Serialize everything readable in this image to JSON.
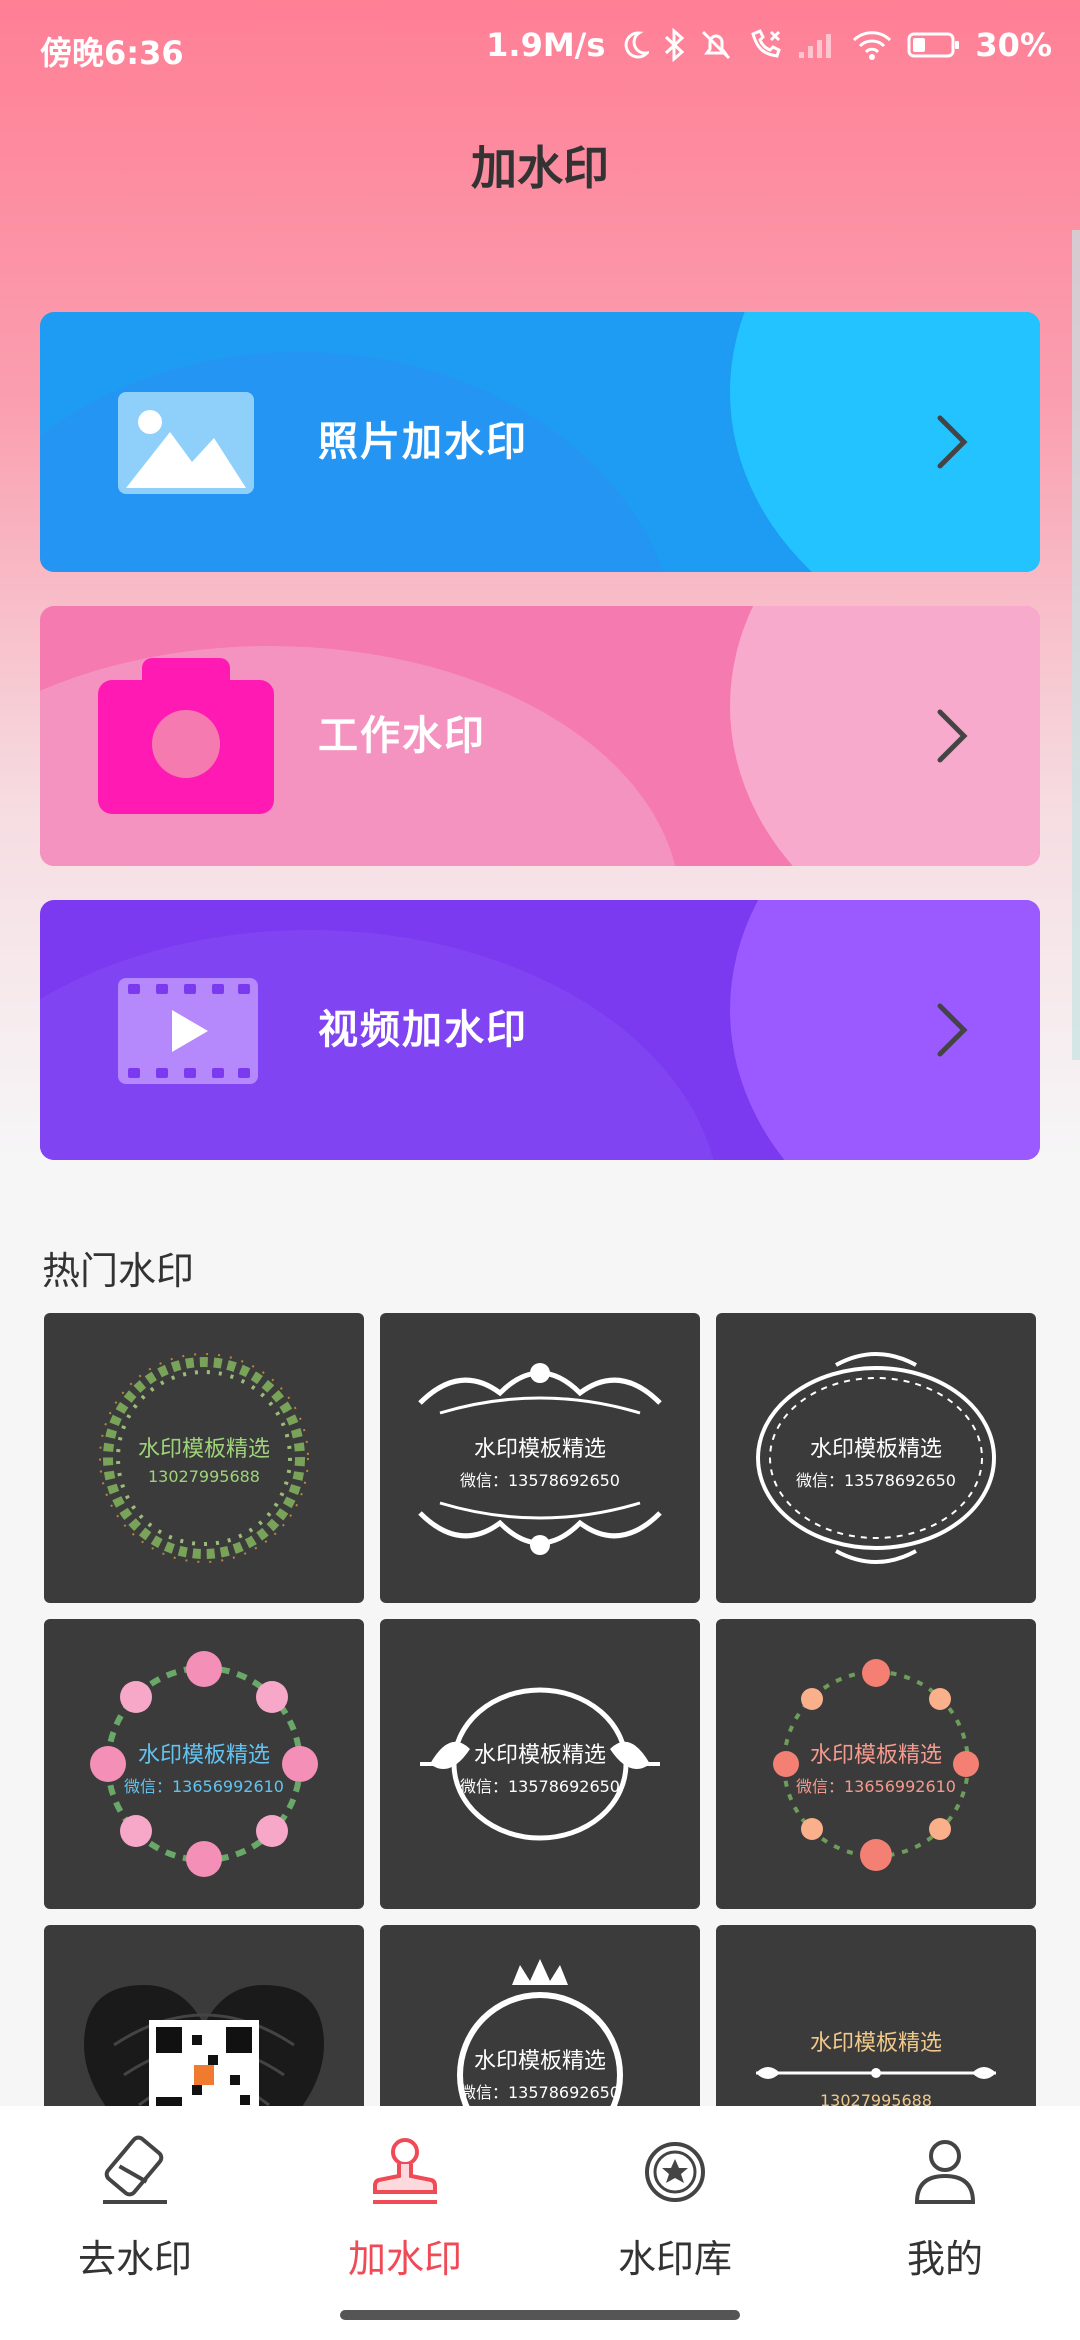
{
  "status_bar": {
    "time": "傍晚6:36",
    "network_speed": "1.9M/s",
    "battery": "30%",
    "icons": [
      "moon-icon",
      "bluetooth-icon",
      "mute-bell-icon",
      "call-missed-icon",
      "signal-icon",
      "wifi-icon",
      "battery-icon"
    ]
  },
  "header": {
    "title": "加水印"
  },
  "cards": [
    {
      "label": "照片加水印",
      "icon": "image-icon"
    },
    {
      "label": "工作水印",
      "icon": "camera-icon"
    },
    {
      "label": "视频加水印",
      "icon": "video-icon"
    }
  ],
  "hot_section": {
    "title": "热门水印",
    "templates": [
      {
        "title": "水印模板精选",
        "subtitle": "13027995688",
        "style": "green-wreath",
        "text_color": "#9fd37a"
      },
      {
        "title": "水印模板精选",
        "subtitle": "微信：13578692650",
        "style": "white-ornament",
        "text_color": "#ffffff"
      },
      {
        "title": "水印模板精选",
        "subtitle": "微信：13578692650",
        "style": "white-circle-frame",
        "text_color": "#ffffff"
      },
      {
        "title": "水印模板精选",
        "subtitle": "微信：13656992610",
        "style": "pink-flower-wreath",
        "text_color": "#63c3f0"
      },
      {
        "title": "水印模板精选",
        "subtitle": "微信：13578692650",
        "style": "white-badge",
        "text_color": "#ffffff"
      },
      {
        "title": "水印模板精选",
        "subtitle": "微信：13656992610",
        "style": "coral-flower-wreath",
        "text_color": "#f59a8e"
      },
      {
        "title": "",
        "subtitle": "",
        "style": "fingerprint-qr",
        "text_color": "#ffffff"
      },
      {
        "title": "水印模板精选",
        "subtitle": "微信：13578692650",
        "style": "crown-circle",
        "text_color": "#ffffff"
      },
      {
        "title": "水印模板精选",
        "subtitle": "13027995688",
        "style": "gold-line",
        "text_color": "#f0c98a"
      }
    ]
  },
  "bottom_nav": {
    "items": [
      {
        "label": "去水印",
        "icon": "eraser-icon",
        "active": false
      },
      {
        "label": "加水印",
        "icon": "stamp-icon",
        "active": true
      },
      {
        "label": "水印库",
        "icon": "star-badge-icon",
        "active": false
      },
      {
        "label": "我的",
        "icon": "user-icon",
        "active": false
      }
    ]
  },
  "colors": {
    "accent": "#ef4a56",
    "photo_card": "#1e9bf3",
    "work_card": "#f47ab0",
    "video_card": "#7b39f0",
    "tile_bg": "#3b3b3b"
  }
}
